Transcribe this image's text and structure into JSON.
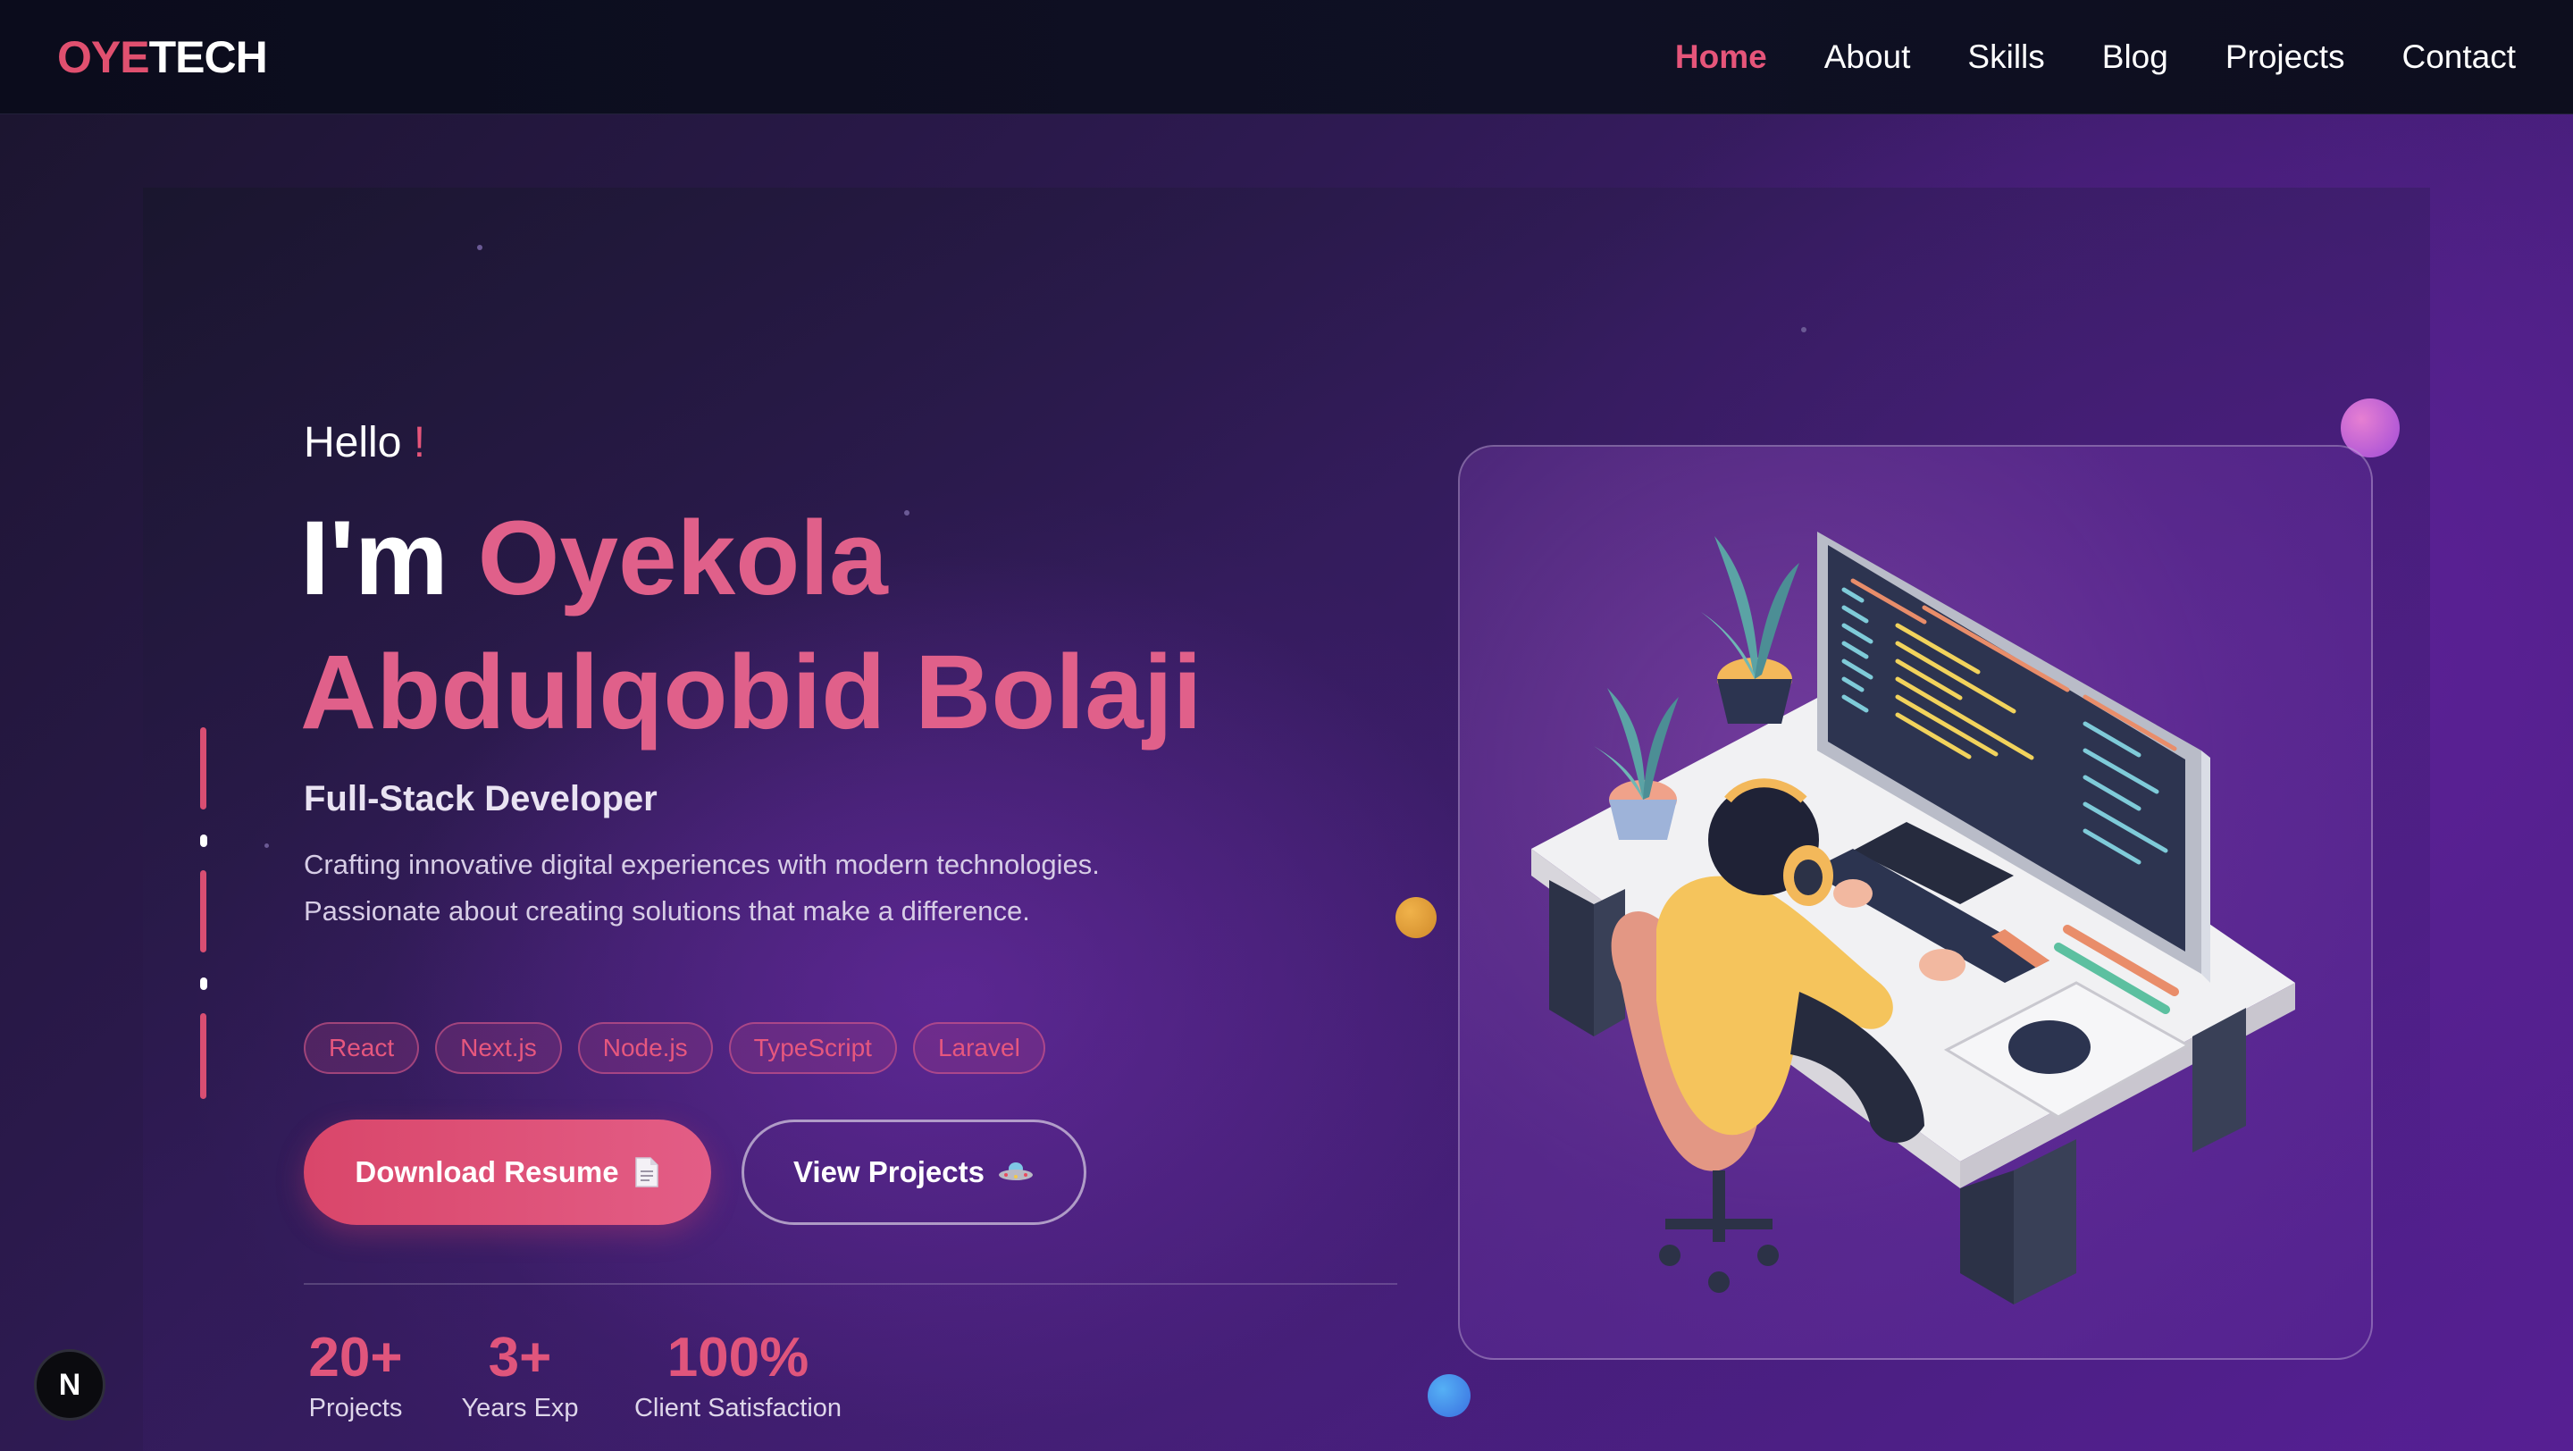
{
  "nav": {
    "logo": {
      "o": "O",
      "ye": "YE",
      "tech": "TECH"
    },
    "links": [
      "Home",
      "About",
      "Skills",
      "Blog",
      "Projects",
      "Contact"
    ],
    "active": "Home"
  },
  "hero": {
    "greeting": "Hello",
    "greeting_mark": "!",
    "im": "I'm",
    "first_name": "Oyekola",
    "rest_name": "Abdulqobid Bolaji",
    "role": "Full-Stack Developer",
    "description": "Crafting innovative digital experiences with modern technologies. Passionate about creating solutions that make a difference.",
    "tags": [
      "React",
      "Next.js",
      "Node.js",
      "TypeScript",
      "Laravel"
    ],
    "buttons": {
      "resume": "Download Resume",
      "resume_icon": "document-icon",
      "projects": "View Projects",
      "projects_icon": "ufo-icon"
    },
    "stats": [
      {
        "value": "20+",
        "label": "Projects"
      },
      {
        "value": "3+",
        "label": "Years Exp"
      },
      {
        "value": "100%",
        "label": "Client Satisfaction"
      }
    ]
  },
  "next_badge": "N",
  "colors": {
    "accent": "#e0557c",
    "nav_bg": "#0d0e1e",
    "bg_purple": "#561f93"
  }
}
